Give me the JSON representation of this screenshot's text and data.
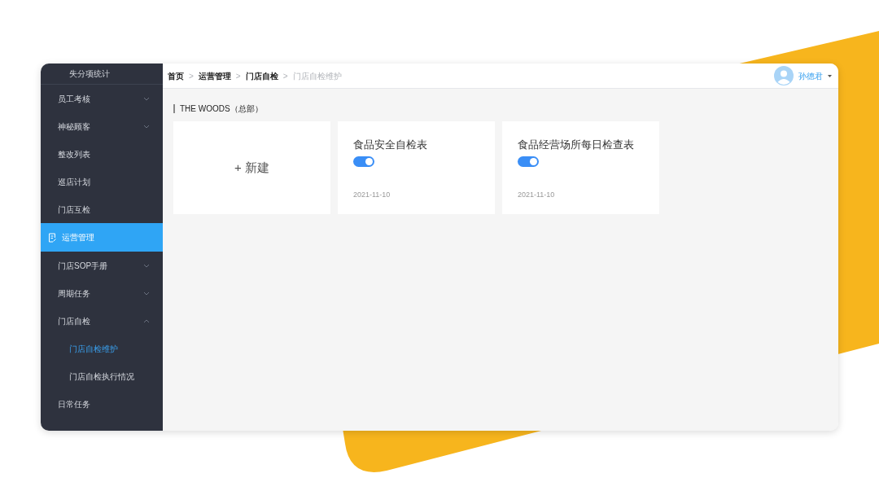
{
  "sidebar": {
    "items": [
      {
        "kind": "sub",
        "label": "失分项统计",
        "selected": false
      },
      {
        "kind": "group",
        "label": "员工考核",
        "expanded": false,
        "selected": false
      },
      {
        "kind": "group",
        "label": "神秘顾客",
        "expanded": false,
        "selected": false
      },
      {
        "kind": "item",
        "label": "整改列表",
        "selected": false
      },
      {
        "kind": "item",
        "label": "巡店计划",
        "selected": false
      },
      {
        "kind": "item",
        "label": "门店互检",
        "selected": false
      },
      {
        "kind": "section",
        "label": "运营管理",
        "selected": true
      },
      {
        "kind": "group",
        "label": "门店SOP手册",
        "expanded": false,
        "selected": false
      },
      {
        "kind": "group",
        "label": "周期任务",
        "expanded": false,
        "selected": false
      },
      {
        "kind": "group",
        "label": "门店自检",
        "expanded": true,
        "selected": false
      },
      {
        "kind": "sub",
        "label": "门店自检维护",
        "selected": true
      },
      {
        "kind": "sub",
        "label": "门店自检执行情况",
        "selected": false
      },
      {
        "kind": "item",
        "label": "日常任务",
        "selected": false
      }
    ]
  },
  "breadcrumb": [
    "首页",
    "运营管理",
    "门店自检",
    "门店自检维护"
  ],
  "breadcrumb_separator": ">",
  "user": {
    "name": "孙德君"
  },
  "section_title": "THE WOODS（总部）",
  "cards": [
    {
      "kind": "new",
      "symbol": "+",
      "label": "新建"
    },
    {
      "kind": "form",
      "title": "食品安全自检表",
      "on": true,
      "date": "2021-11-10"
    },
    {
      "kind": "form",
      "title": "食品经营场所每日检查表",
      "on": true,
      "date": "2021-11-10"
    }
  ]
}
